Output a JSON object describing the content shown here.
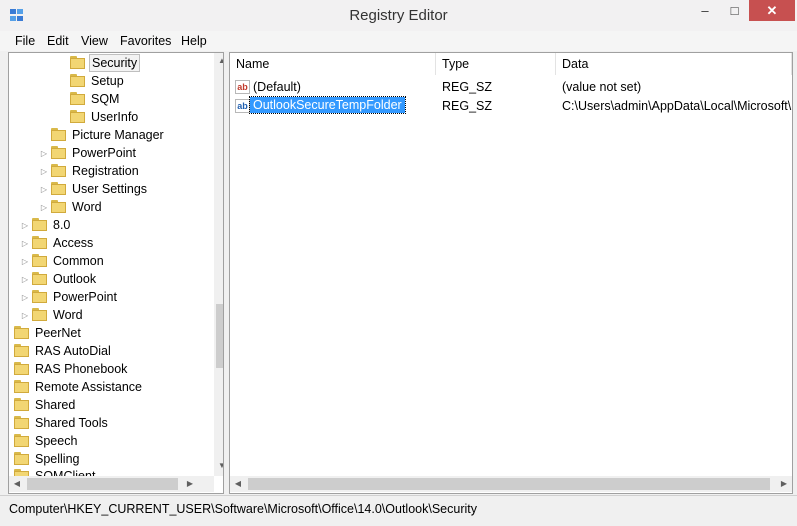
{
  "window": {
    "title": "Registry Editor",
    "minimize": "–",
    "maximize": "□",
    "close": "✕"
  },
  "menu": [
    "File",
    "Edit",
    "View",
    "Favorites",
    "Help"
  ],
  "tree": {
    "items": [
      {
        "label": "Security",
        "selected": true
      },
      {
        "label": "Setup"
      },
      {
        "label": "SQM"
      },
      {
        "label": "UserInfo"
      },
      {
        "label": "Picture Manager"
      },
      {
        "label": "PowerPoint"
      },
      {
        "label": "Registration"
      },
      {
        "label": "User Settings"
      },
      {
        "label": "Word"
      },
      {
        "label": "8.0"
      },
      {
        "label": "Access"
      },
      {
        "label": "Common"
      },
      {
        "label": "Outlook"
      },
      {
        "label": "PowerPoint"
      },
      {
        "label": "Word"
      },
      {
        "label": "PeerNet"
      },
      {
        "label": "RAS AutoDial"
      },
      {
        "label": "RAS Phonebook"
      },
      {
        "label": "Remote Assistance"
      },
      {
        "label": "Shared"
      },
      {
        "label": "Shared Tools"
      },
      {
        "label": "Speech"
      },
      {
        "label": "Spelling"
      },
      {
        "label": "SQMClient"
      }
    ]
  },
  "list": {
    "columns": [
      "Name",
      "Type",
      "Data"
    ],
    "rows": [
      {
        "name": "(Default)",
        "type": "REG_SZ",
        "data": "(value not set)",
        "icon": "ab",
        "selected": false
      },
      {
        "name": "OutlookSecureTempFolder",
        "type": "REG_SZ",
        "data": "C:\\Users\\admin\\AppData\\Local\\Microsoft\\",
        "icon": "ab",
        "selected": true
      }
    ]
  },
  "status": {
    "path": "Computer\\HKEY_CURRENT_USER\\Software\\Microsoft\\Office\\14.0\\Outlook\\Security"
  }
}
